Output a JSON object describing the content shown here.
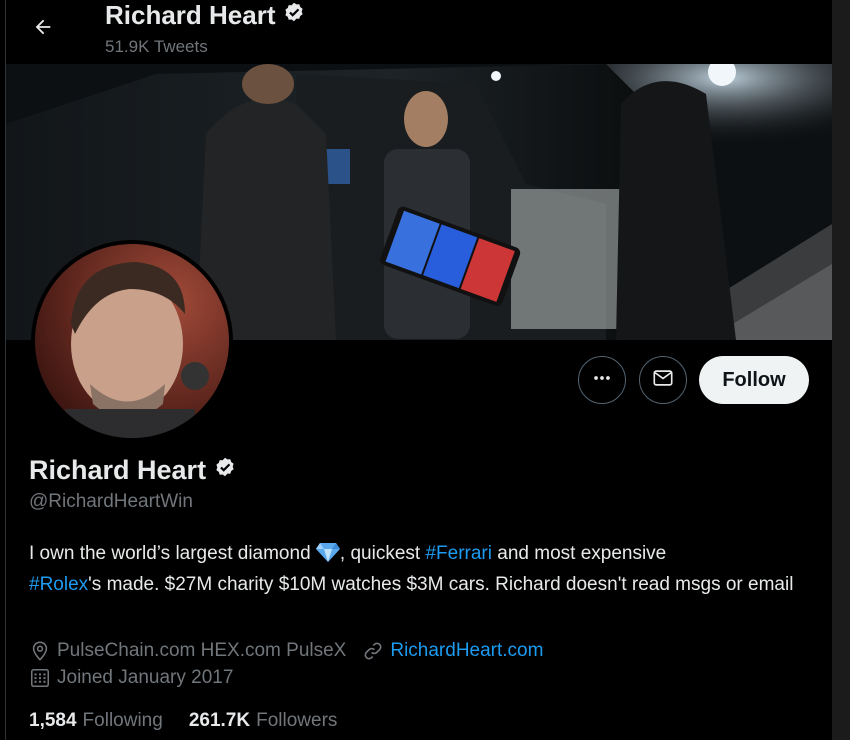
{
  "header": {
    "name": "Richard Heart",
    "tweet_count": "51.9K Tweets"
  },
  "profile": {
    "display_name": "Richard Heart",
    "handle": "@RichardHeartWin",
    "bio_part1": "I own the world’s largest diamond ",
    "bio_part2": ", quickest ",
    "bio_link1": "#Ferrari",
    "bio_part3": " and most expensive ",
    "bio_link2": "#Rolex",
    "bio_part4": "'s made. $27M charity $10M watches $3M cars. Richard doesn't read msgs or email",
    "location": "PulseChain.com HEX.com PulseX",
    "website": "RichardHeart.com",
    "joined": "Joined January 2017"
  },
  "actions": {
    "follow_label": "Follow"
  },
  "stats": {
    "following_count": "1,584",
    "following_label": "Following",
    "followers_count": "261.7K",
    "followers_label": "Followers"
  },
  "icons": {
    "back": "arrow-left-icon",
    "verified": "verified-badge-icon",
    "more": "more-horizontal-icon",
    "message": "envelope-icon",
    "location": "location-pin-icon",
    "link": "link-icon",
    "calendar": "calendar-icon",
    "diamond": "diamond-emoji-icon"
  },
  "colors": {
    "background": "#000000",
    "link": "#1d9bf0",
    "verified": "#e7e9ea",
    "secondary_text": "#71767b",
    "follow_button_bg": "#eff3f4"
  }
}
